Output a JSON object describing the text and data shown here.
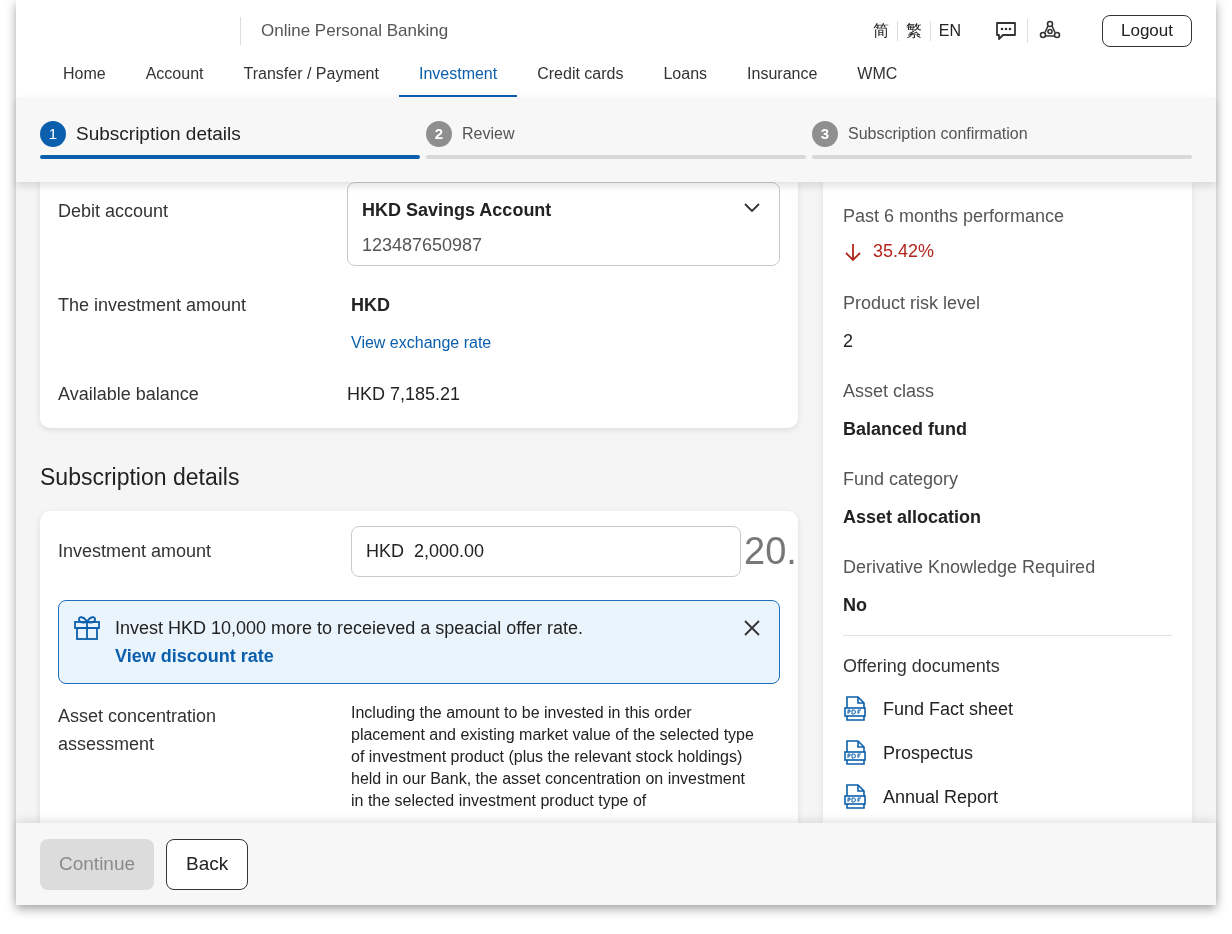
{
  "header": {
    "title": "Online Personal Banking",
    "languages": [
      {
        "label": "简"
      },
      {
        "label": "繁"
      },
      {
        "label": "EN"
      }
    ],
    "logout": "Logout"
  },
  "nav": [
    {
      "label": "Home",
      "selected": false
    },
    {
      "label": "Account",
      "selected": false
    },
    {
      "label": "Transfer / Payment",
      "selected": false
    },
    {
      "label": "Investment",
      "selected": true
    },
    {
      "label": "Credit cards",
      "selected": false
    },
    {
      "label": "Loans",
      "selected": false
    },
    {
      "label": "Insurance",
      "selected": false
    },
    {
      "label": "WMC",
      "selected": false
    }
  ],
  "steps": [
    {
      "number": "1",
      "label": "Subscription details",
      "selected": true
    },
    {
      "number": "2",
      "label": "Review",
      "selected": false
    },
    {
      "number": "3",
      "label": "Subscription confirmation",
      "selected": false
    }
  ],
  "debit_account": {
    "label": "Debit account",
    "account_name": "HKD Savings Account",
    "account_number": "123487650987"
  },
  "investment_currency": {
    "label": "The investment amount",
    "value": "HKD",
    "link": "View exchange rate"
  },
  "available_balance": {
    "label": "Available balance",
    "value": "HKD 7,185.21"
  },
  "subscription": {
    "heading": "Subscription details",
    "amount": {
      "label": "Investment amount",
      "currency": "HKD",
      "value": "2,000.00"
    },
    "overflow_text": "20.",
    "offer_banner": {
      "text": "Invest HKD 10,000 more to receieved a speacial offer rate.",
      "link": "View discount rate"
    },
    "assessment": {
      "label": "Asset concentration assessment",
      "text": "Including the amount to be invested in this order placement and existing market value of the selected type of investment product (plus the relevant stock holdings) held in our Bank, the asset concentration on investment in the selected investment product type of"
    }
  },
  "fund_summary": {
    "performance": {
      "label": "Past 6 months performance",
      "value": "35.42%"
    },
    "details": [
      {
        "label": "Product risk level",
        "value": "2"
      },
      {
        "label": "Asset class",
        "value": "Balanced fund"
      },
      {
        "label": "Fund category",
        "value": "Asset allocation"
      },
      {
        "label": "Derivative Knowledge Required",
        "value": "No"
      }
    ],
    "documents": {
      "heading": "Offering documents",
      "items": [
        "Fund Fact sheet",
        "Prospectus",
        "Annual Report"
      ]
    }
  },
  "footer": {
    "continue": {
      "label": "Continue",
      "disabled": true
    },
    "back": "Back"
  }
}
